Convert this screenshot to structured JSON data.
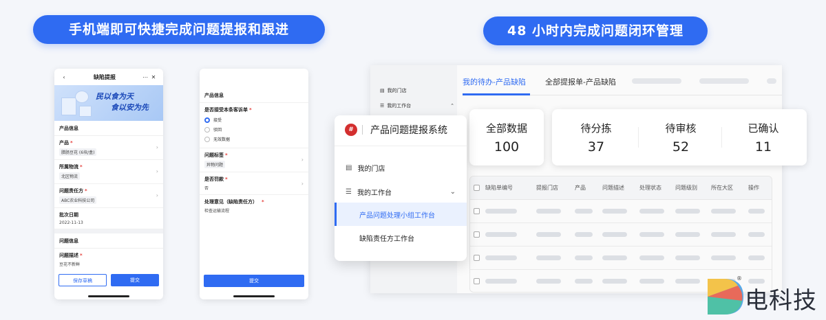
{
  "headlines": {
    "left": "手机端即可快捷完成问题提报和跟进",
    "right": "48 小时内完成问题闭环管理"
  },
  "phone1": {
    "title": "缺陷提报",
    "more_icon": "more-icon",
    "close_icon": "close-icon",
    "banner_line1": "民以食为天",
    "banner_line2": "食以安为先",
    "section_product": "产品信息",
    "fields": [
      {
        "label": "产品",
        "value": "腊肠豆花 (6块/盒)"
      },
      {
        "label": "所属物流",
        "value": "北区物流"
      },
      {
        "label": "问题责任方",
        "value": "ABC农业科技公司"
      },
      {
        "label": "批次日期",
        "value": "2022-11-13"
      }
    ],
    "section_issue": "问题信息",
    "issue_label": "问题描述",
    "issue_value": "豆花不新鲜",
    "btn_save": "保存草稿",
    "btn_submit": "提交"
  },
  "phone2": {
    "section_product": "产品信息",
    "accept_label": "是否接受本条客诉单",
    "options": [
      "接受",
      "驳回",
      "无效数据"
    ],
    "tag_label": "问题标签",
    "tag_value": "异物问题",
    "penalty_label": "是否罚款",
    "penalty_value": "否",
    "opinion_label": "处理意见（缺陷责任方）",
    "opinion_value": "检查运输流程",
    "btn_submit": "提交"
  },
  "desktop": {
    "side_items": [
      "我的门店",
      "我的工作台"
    ],
    "tabs": [
      "我的待办-产品缺陷",
      "全部提报单-产品缺陷"
    ],
    "stats": [
      {
        "label": "全部数据",
        "value": "100"
      },
      {
        "label": "待分拣",
        "value": "37"
      },
      {
        "label": "待审核",
        "value": "52"
      },
      {
        "label": "已确认",
        "value": "11"
      }
    ],
    "columns": [
      "缺陷单编号",
      "提报门店",
      "产品",
      "问题描述",
      "处理状态",
      "问题级别",
      "所在大区",
      "操作"
    ]
  },
  "menu": {
    "title": "产品问题提报系统",
    "items": [
      "我的门店",
      "我的工作台",
      "产品问题处理小组工作台",
      "缺陷责任方工作台"
    ]
  },
  "watermark": {
    "text": "电科技",
    "mark": "®"
  },
  "colors": {
    "accent": "#2f6bf2",
    "logo_red": "#d32f2f"
  }
}
